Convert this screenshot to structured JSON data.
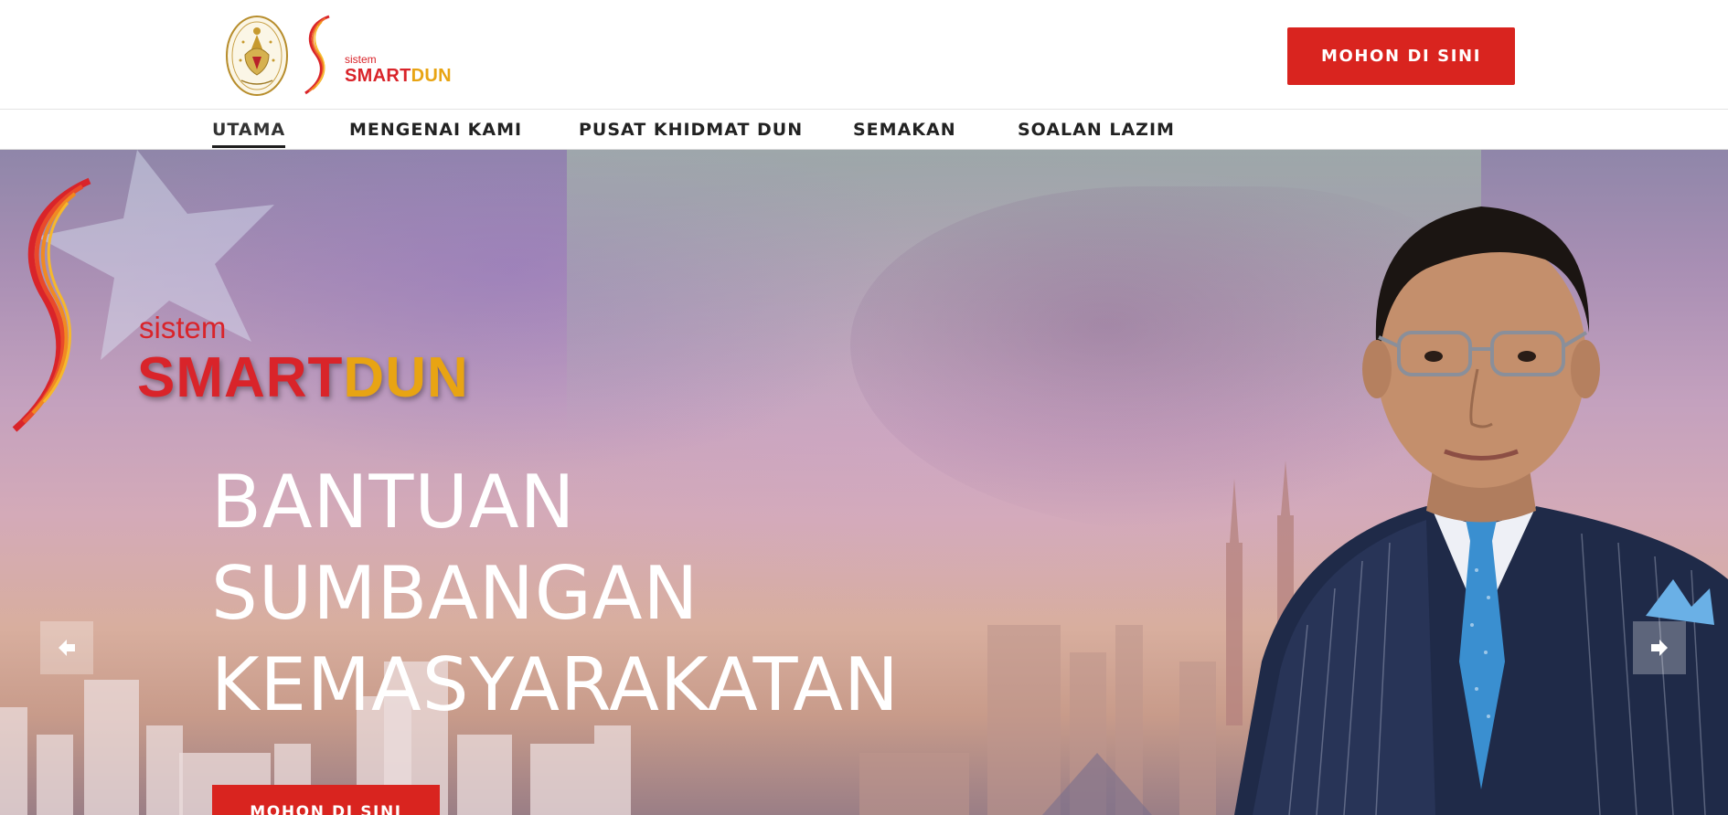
{
  "header": {
    "brand_small": "sistem",
    "brand_red": "SMART",
    "brand_gold": "DUN",
    "apply_label": "MOHON DI SINI"
  },
  "nav": {
    "items": [
      {
        "label": "UTAMA",
        "active": true
      },
      {
        "label": "MENGENAI KAMI",
        "active": false
      },
      {
        "label": "PUSAT KHIDMAT DUN",
        "active": false
      },
      {
        "label": "SEMAKAN",
        "active": false
      },
      {
        "label": "SOALAN LAZIM",
        "active": false
      }
    ]
  },
  "hero": {
    "brand_small": "sistem",
    "brand_red": "SMART",
    "brand_gold": "DUN",
    "headline": [
      "BANTUAN",
      "SUMBANGAN",
      "KEMASYARAKATAN"
    ],
    "apply_label": "MOHON DI SINI",
    "prev_icon": "arrow-left-icon",
    "next_icon": "arrow-right-icon"
  },
  "colors": {
    "accent_red": "#d9241f",
    "brand_gold": "#e8a413",
    "nav_text": "#222222"
  }
}
